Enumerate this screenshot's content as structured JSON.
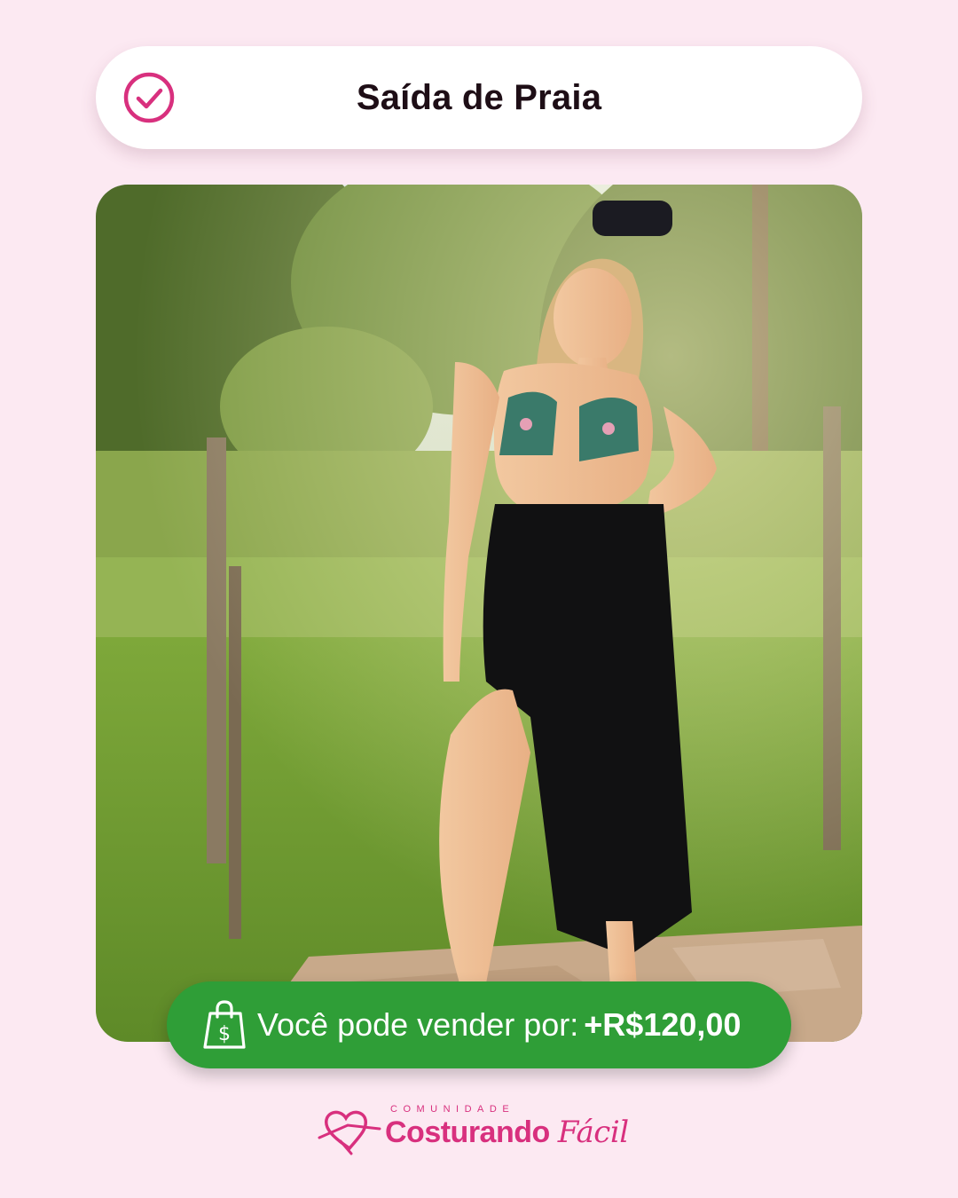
{
  "header": {
    "title": "Saída de Praia"
  },
  "photo": {
    "description_icon": "photo"
  },
  "price_banner": {
    "label": "Você pode vender por:",
    "value": "+R$120,00"
  },
  "brand": {
    "small_text": "COMUNIDADE",
    "name_bold": "Costurando",
    "name_script": "Fácil"
  },
  "colors": {
    "background": "#fce9f2",
    "accent": "#d8307e",
    "green": "#2f9e37"
  }
}
